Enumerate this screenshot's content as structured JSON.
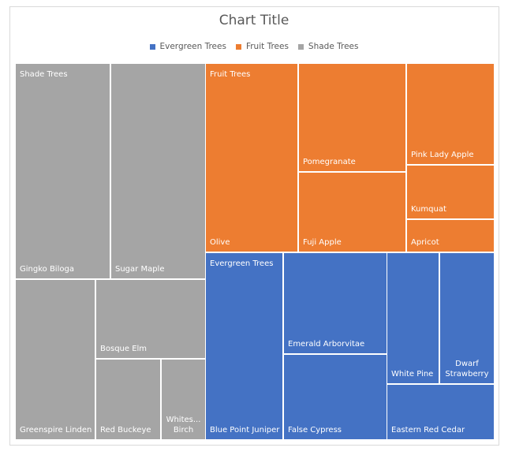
{
  "chart_data": {
    "type": "treemap",
    "title": "Chart Title",
    "legend": {
      "position": "top",
      "entries": [
        {
          "name": "Evergreen Trees",
          "color": "#4472c4"
        },
        {
          "name": "Fruit Trees",
          "color": "#ed7d31"
        },
        {
          "name": "Shade Trees",
          "color": "#a5a5a5"
        }
      ]
    },
    "value_note": "Values estimated from relative tile areas (no data labels shown)",
    "groups": [
      {
        "name": "Shade Trees",
        "color": "#a5a5a5",
        "items": [
          {
            "name": "Gingko Biloga",
            "value": 32
          },
          {
            "name": "Sugar Maple",
            "value": 32
          },
          {
            "name": "Greenspire Linden",
            "value": 20
          },
          {
            "name": "Bosque Elm",
            "value": 14
          },
          {
            "name": "Red Buckeye",
            "value": 8
          },
          {
            "name": "Whitespire Birch",
            "display": "Whites... Birch",
            "value": 6
          }
        ]
      },
      {
        "name": "Fruit Trees",
        "color": "#ed7d31",
        "items": [
          {
            "name": "Olive",
            "value": 28
          },
          {
            "name": "Pomegranate",
            "value": 18
          },
          {
            "name": "Fuji Apple",
            "value": 14
          },
          {
            "name": "Pink Lady Apple",
            "value": 14
          },
          {
            "name": "Kumquat",
            "value": 7
          },
          {
            "name": "Apricot",
            "value": 4
          }
        ]
      },
      {
        "name": "Evergreen Trees",
        "color": "#4472c4",
        "items": [
          {
            "name": "Blue Point Juniper",
            "value": 23
          },
          {
            "name": "Emerald Arborvitae",
            "value": 17
          },
          {
            "name": "False Cypress",
            "value": 14
          },
          {
            "name": "White Pine",
            "value": 11
          },
          {
            "name": "Dwarf Strawberry",
            "value": 11
          },
          {
            "name": "Eastern Red Cedar",
            "value": 9
          }
        ]
      }
    ]
  }
}
